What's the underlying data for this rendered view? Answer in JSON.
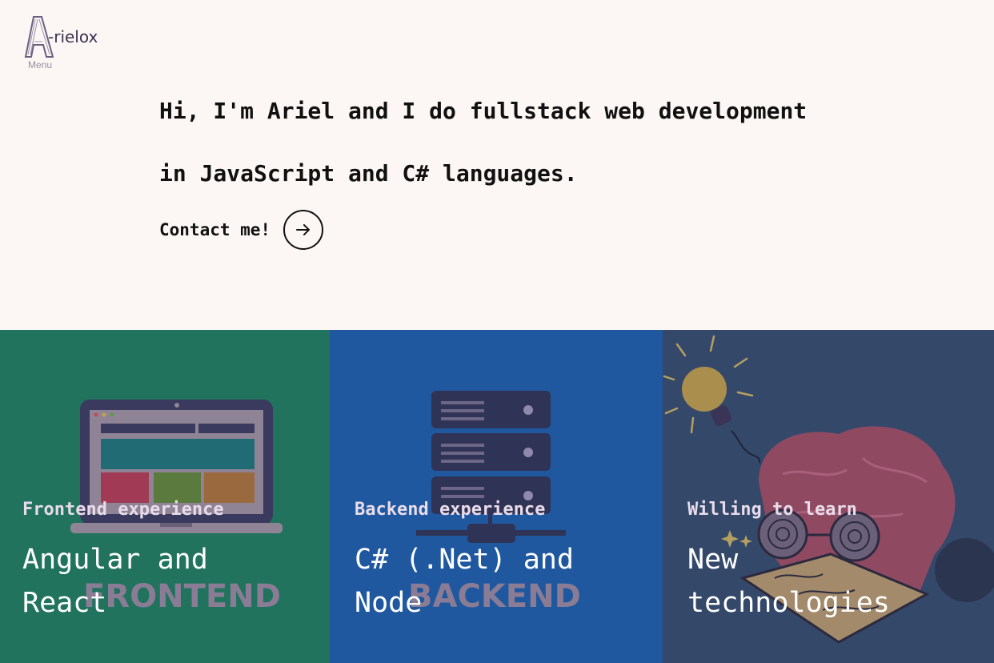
{
  "brand": {
    "logo_letter": "A",
    "name": "-rielox",
    "menu_label": "Menu"
  },
  "hero": {
    "line1": "Hi, I'm Ariel and I do fullstack web development",
    "line2": "in JavaScript and C# languages.",
    "cta_label": "Contact me!"
  },
  "cards": [
    {
      "kicker": "Frontend experience",
      "title_line1": "Angular and",
      "title_line2": "React",
      "watermark": "FRONTEND",
      "bg": "#21735e"
    },
    {
      "kicker": "Backend experience",
      "title_line1": "C# (.Net) and",
      "title_line2": "Node",
      "watermark": "BACKEND",
      "bg": "#2058a0"
    },
    {
      "kicker": "Willing to learn",
      "title_line1": "New",
      "title_line2": "technologies",
      "watermark": "",
      "bg": "#34486a"
    }
  ],
  "icons": {
    "cta": "arrow-right-icon",
    "frontend": "laptop-icon",
    "backend": "server-icon",
    "learn": "brain-lightbulb-icon"
  },
  "colors": {
    "page_bg": "#fcf7f4",
    "text": "#111111",
    "kicker": "#e8dcea"
  }
}
